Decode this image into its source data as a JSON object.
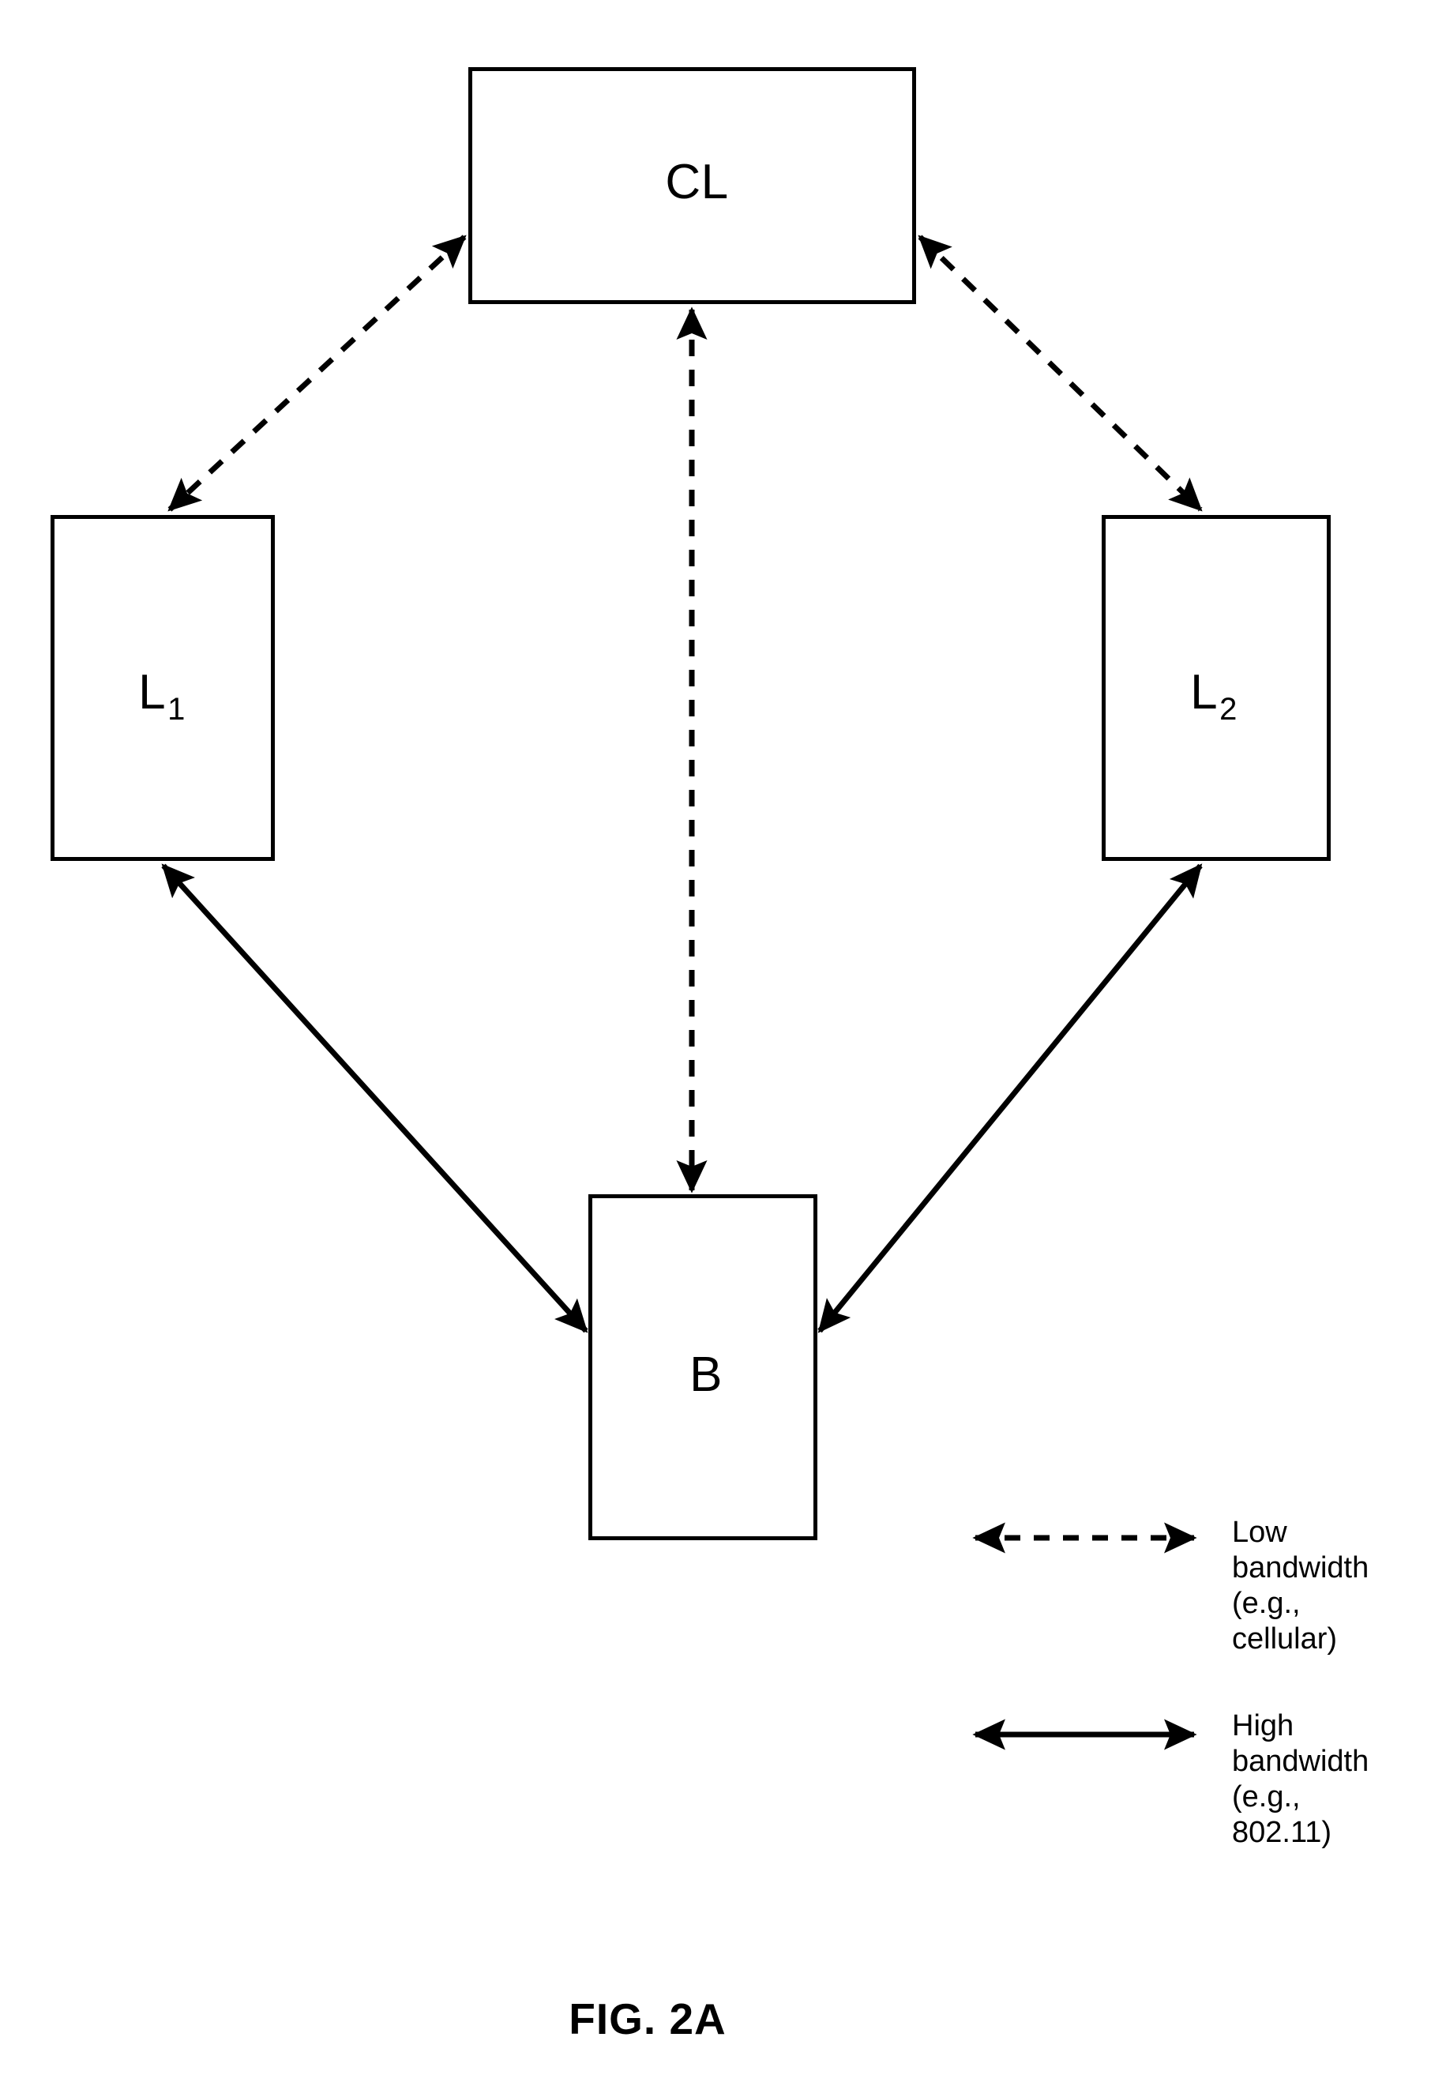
{
  "figure": {
    "caption": "FIG. 2A",
    "nodes": [
      {
        "id": "cl",
        "label": "CL",
        "base": "CL",
        "subscript": ""
      },
      {
        "id": "l1",
        "label": "L1",
        "base": "L",
        "subscript": "1"
      },
      {
        "id": "l2",
        "label": "L2",
        "base": "L",
        "subscript": "2"
      },
      {
        "id": "b",
        "label": "B",
        "base": "B",
        "subscript": ""
      }
    ],
    "connections": [
      {
        "from": "CL",
        "to": "L1",
        "style": "dashed",
        "arrows": "both",
        "bandwidth": "low"
      },
      {
        "from": "CL",
        "to": "L2",
        "style": "dashed",
        "arrows": "both",
        "bandwidth": "low"
      },
      {
        "from": "CL",
        "to": "B",
        "style": "dashed",
        "arrows": "both",
        "bandwidth": "low"
      },
      {
        "from": "L1",
        "to": "B",
        "style": "solid",
        "arrows": "both",
        "bandwidth": "high"
      },
      {
        "from": "L2",
        "to": "B",
        "style": "solid",
        "arrows": "both",
        "bandwidth": "high"
      }
    ]
  },
  "legend": {
    "items": [
      {
        "style": "dashed",
        "label": "Low\nbandwidth\n(e.g.,\ncellular)"
      },
      {
        "style": "solid",
        "label": "High\nbandwidth\n(e.g.,\n802.11)"
      }
    ]
  },
  "colors": {
    "line": "#000000",
    "background": "#ffffff"
  }
}
